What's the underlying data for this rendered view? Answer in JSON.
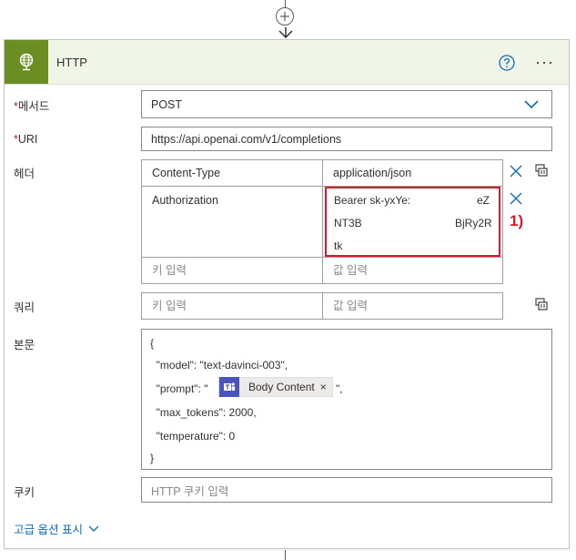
{
  "card": {
    "title": "HTTP"
  },
  "method": {
    "label": "메서드",
    "required_mark": "*",
    "value": "POST"
  },
  "uri": {
    "label": "URI",
    "required_mark": "*",
    "value": "https://api.openai.com/v1/completions"
  },
  "headers": {
    "label": "헤더",
    "rows": [
      {
        "key": "Content-Type",
        "value": "application/json"
      },
      {
        "key": "Authorization",
        "value_lines": [
          {
            "left": "Bearer sk-yxYe:",
            "right": "eZ"
          },
          {
            "left": "NT3B",
            "right": "BjRy2R"
          },
          {
            "left": "tk",
            "right": ""
          }
        ]
      }
    ],
    "key_placeholder": "키 입력",
    "value_placeholder": "값 입력"
  },
  "annotation": {
    "text": "1)",
    "color": "#e3152b"
  },
  "queries": {
    "label": "쿼리",
    "key_placeholder": "키 입력",
    "value_placeholder": "값 입력"
  },
  "body": {
    "label": "본문",
    "lines": [
      "{",
      "  \"model\": \"text-davinci-003\",",
      "  \"prompt\": \"",
      "  \"max_tokens\": 2000,",
      "  \"temperature\": 0",
      "}"
    ],
    "prompt_suffix": "\",",
    "token": {
      "label": "Body Content",
      "remove": "×",
      "icon": "teams-icon"
    }
  },
  "cookie": {
    "label": "쿠키",
    "placeholder": "HTTP 쿠키 입력"
  },
  "advanced": {
    "label": "고급 옵션 표시"
  },
  "colors": {
    "header_bg": "#f1f5e8",
    "icon_bg": "#6b8e23",
    "link": "#0f6cbd",
    "accent": "#0f6cbd",
    "annotation": "#e3152b"
  }
}
